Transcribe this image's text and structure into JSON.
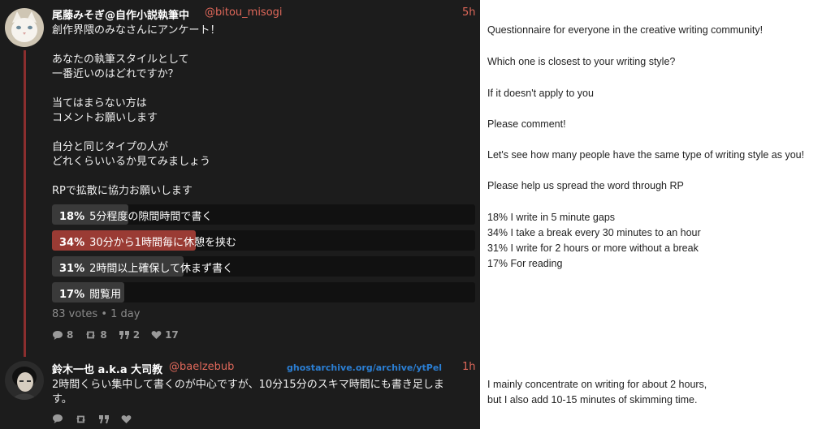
{
  "post1": {
    "author_name": "尾藤みそぎ@自作小説執筆中",
    "author_handle": "@bitou_misogi",
    "time": "5h",
    "text": "創作界隈のみなさんにアンケート！\n\nあなたの執筆スタイルとして\n一番近いのはどれですか？\n\n当てはまらない方は\nコメントお願いします\n\n自分と同じタイプの人が\nどれくらいいるか見てみましょう\n\nRPで拡散に協力お願いします",
    "poll": [
      {
        "percent": "18%",
        "label": "5分程度の隙間時間で書く",
        "value": 18,
        "leading": false
      },
      {
        "percent": "34%",
        "label": "30分から1時間毎に休憩を挟む",
        "value": 34,
        "leading": true
      },
      {
        "percent": "31%",
        "label": "2時間以上確保して休まず書く",
        "value": 31,
        "leading": false
      },
      {
        "percent": "17%",
        "label": "閲覧用",
        "value": 17,
        "leading": false
      }
    ],
    "votes": "83 votes • 1 day",
    "replies": "8",
    "reposts": "8",
    "quotes": "2",
    "likes": "17"
  },
  "post2": {
    "author_name": "鈴木一也 a.k.a 大司教",
    "author_handle": "@baelzebub",
    "watermark": "ghostarchive.org/archive/ytPel",
    "time": "1h",
    "text": "2時間くらい集中して書くのが中心ですが、10分15分のスキマ時間にも書き足しま\nす。"
  },
  "translation": {
    "lines": [
      "Questionnaire for everyone in the creative writing community!",
      "Which one is closest to your writing style?",
      "If it doesn't apply to you",
      "Please comment!",
      "Let's see how many people have the same type of writing style as you!",
      "Please help us spread the word through RP",
      "18% I write in 5 minute gaps",
      "34% I take a break every 30 minutes to an hour",
      "31% I write for 2 hours or more without a break",
      "17% For reading",
      "I mainly concentrate on writing for about 2 hours,",
      "but I also add 10-15 minutes of skimming time."
    ]
  },
  "colors": {
    "accent": "#e0685a",
    "poll_leading": "#9a3b34",
    "poll_bar": "#3a3a3a",
    "thread_line": "#8b2e2e",
    "watermark": "#2b7fd4"
  }
}
